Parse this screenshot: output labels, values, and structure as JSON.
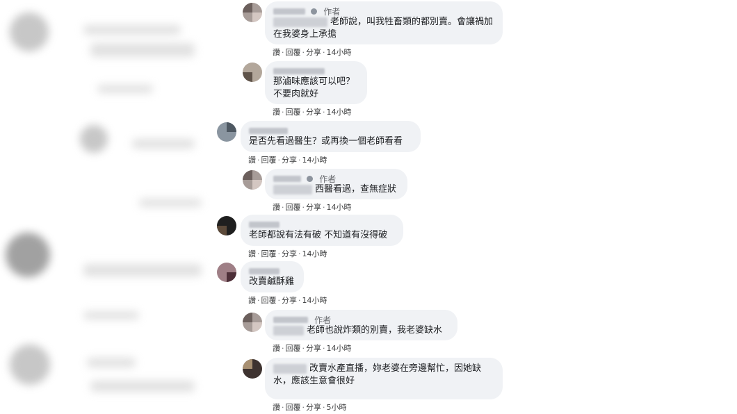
{
  "author_label": "作者",
  "action_labels": {
    "like": "讚",
    "reply": "回覆",
    "share": "分享",
    "sep": "·"
  },
  "comments": [
    {
      "is_author": true,
      "text": "老師說，叫我牲畜類的都別賣。會讓禍加在我婆身上承擔",
      "time": "14小時"
    },
    {
      "is_author": false,
      "text": "那滷味應該可以吧？不要肉就好",
      "time": "14小時"
    },
    {
      "is_author": false,
      "text": "是否先看過醫生？或再換一個老師看看",
      "time": "14小時"
    },
    {
      "is_author": true,
      "text": "西醫看過，查無症狀",
      "time": "14小時"
    },
    {
      "is_author": false,
      "text": "老師都說有法有破 不知道有沒得破",
      "time": "14小時"
    },
    {
      "is_author": false,
      "text": "改賣鹹酥雞",
      "time": "14小時"
    },
    {
      "is_author": true,
      "text": "老師也說炸類的別賣，我老婆缺水",
      "time": "14小時"
    },
    {
      "is_author": false,
      "text": "改賣水產直播，妳老婆在旁邊幫忙，因她缺水，應該生意會很好",
      "time": "5小時"
    }
  ]
}
